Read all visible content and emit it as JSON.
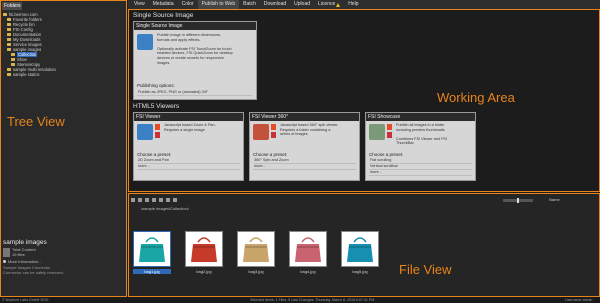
{
  "tree": {
    "tab": "Folders",
    "items": [
      {
        "label": "fsi.bermeo.com",
        "indent": 0,
        "selected": false
      },
      {
        "label": "Favorite folders",
        "indent": 1,
        "selected": false
      },
      {
        "label": "Recycle bin",
        "indent": 1,
        "selected": false
      },
      {
        "label": "FSI Config",
        "indent": 1,
        "selected": false
      },
      {
        "label": "Documentation",
        "indent": 1,
        "selected": false
      },
      {
        "label": "My Downloads",
        "indent": 1,
        "selected": false
      },
      {
        "label": "Service images",
        "indent": 1,
        "selected": false
      },
      {
        "label": "sample images",
        "indent": 1,
        "selected": false
      },
      {
        "label": "Collection",
        "indent": 2,
        "selected": true
      },
      {
        "label": "Shoe",
        "indent": 2,
        "selected": false
      },
      {
        "label": "Stereoscopy",
        "indent": 2,
        "selected": false
      },
      {
        "label": "sample multi resolution",
        "indent": 1,
        "selected": false
      },
      {
        "label": "sample statics",
        "indent": 1,
        "selected": false
      }
    ],
    "overlay": "Tree View",
    "info_title": "sample images",
    "info_lines": [
      "Total Content",
      "19 files"
    ],
    "more_label": "More Information...",
    "desc_lines": [
      "Sample Images Connector",
      "Connector can be safely removed."
    ]
  },
  "menu": {
    "items": [
      {
        "label": "View",
        "active": false,
        "warn": false
      },
      {
        "label": "Metadata",
        "active": false,
        "warn": false
      },
      {
        "label": "Color",
        "active": false,
        "warn": false
      },
      {
        "label": "Publish to Web",
        "active": true,
        "warn": false
      },
      {
        "label": "Batch",
        "active": false,
        "warn": false
      },
      {
        "label": "Download",
        "active": false,
        "warn": false
      },
      {
        "label": "Upload",
        "active": false,
        "warn": false
      },
      {
        "label": "Licence",
        "active": false,
        "warn": true
      },
      {
        "label": "Help",
        "active": false,
        "warn": false
      }
    ]
  },
  "work": {
    "title": "Single Source Image",
    "overlay": "Working Area",
    "single_card": {
      "header": "Single Source Image",
      "desc": [
        "Publish image in different dimensions,",
        "formats and apply effects.",
        "",
        "Optionally activate FSI TouchZoom for touch",
        "enabled devices, FSI QuickZoom for desktop",
        "devices or create srcsets for responsive",
        "images."
      ],
      "sub": "Publishing options:",
      "list": [
        "Publish as JPEG, PNG or (animated) GIF"
      ]
    },
    "html5_title": "HTML5 Viewers",
    "viewer_cards": [
      {
        "header": "FSI Viewer",
        "desc": [
          "Javascript based Zoom & Pan.",
          "Requires a single image"
        ],
        "sub": "Choose a preset:",
        "list": [
          "2D Zoom and Pan",
          "more..."
        ]
      },
      {
        "header": "FSI Viewer 360°",
        "desc": [
          "Javascript based 360° spin viewer.",
          "Requires a folder containing a",
          "series of images"
        ],
        "sub": "Choose a preset:",
        "list": [
          "360° Spin and Zoom",
          "more..."
        ]
      },
      {
        "header": "FSI Showcase",
        "desc": [
          "Publish all images in a folder",
          "including preview thumbnails.",
          "",
          "Combines FSI Viewer and FSI",
          "ThumbBar."
        ],
        "sub": "Choose a preset:",
        "list": [
          "Flat scrolling",
          "Vertical scrollbar",
          "more..."
        ]
      }
    ]
  },
  "files": {
    "overlay": "File View",
    "path": "/sample images/Collection/",
    "sort": "Name",
    "thumbs": [
      {
        "label": "bag1.jpg",
        "selected": true,
        "color": "#1aa6a6"
      },
      {
        "label": "bag2.jpg",
        "selected": false,
        "color": "#c63a2a"
      },
      {
        "label": "bag3.jpg",
        "selected": false,
        "color": "#c8a36a"
      },
      {
        "label": "bag4.jpg",
        "selected": false,
        "color": "#c9636f"
      },
      {
        "label": "bag5.jpg",
        "selected": false,
        "color": "#168fb0"
      }
    ]
  },
  "status": {
    "left": "© Neptune Labs GmbH 2019",
    "mid": "Selected items: 1     Files: 5     Last Changes: Thursday, March 8, 2018 8:07:31 PM",
    "right": "Username admin"
  }
}
